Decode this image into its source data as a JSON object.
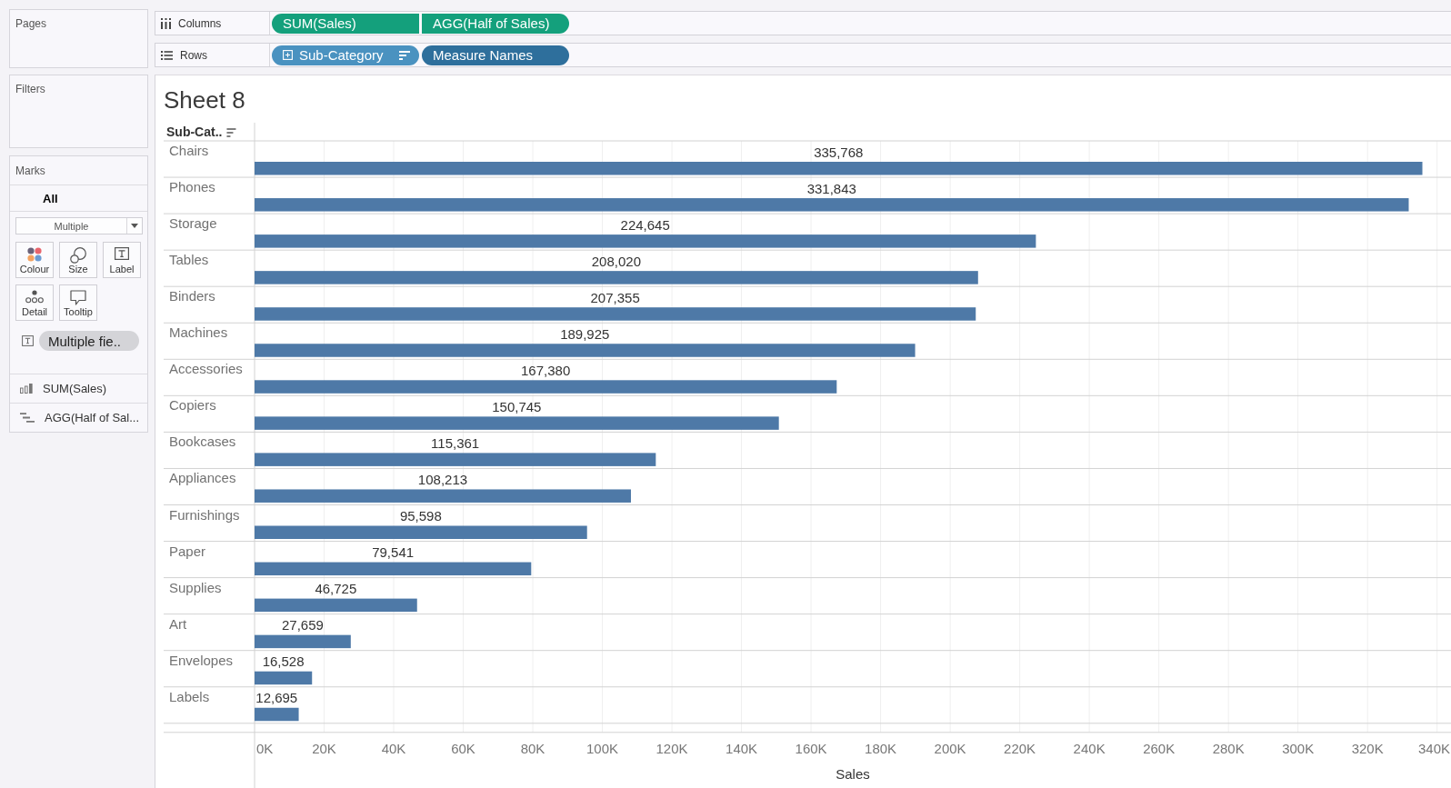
{
  "side_panel": {
    "pages": {
      "title": "Pages"
    },
    "filters": {
      "title": "Filters"
    },
    "marks": {
      "title": "Marks",
      "all_tab": {
        "label": "All",
        "selected": true
      },
      "mark_type": "Multiple",
      "buttons": [
        {
          "kind": "colour",
          "label": "Colour"
        },
        {
          "kind": "size",
          "label": "Size"
        },
        {
          "kind": "label",
          "label": "Label"
        },
        {
          "kind": "detail",
          "label": "Detail"
        },
        {
          "kind": "tooltip",
          "label": "Tooltip"
        }
      ],
      "fields": [
        {
          "kind": "label",
          "text": "Multiple fie.."
        }
      ],
      "measure_tabs": [
        {
          "kind": "bar",
          "label": "SUM(Sales)",
          "selected": false
        },
        {
          "kind": "gantt",
          "label": "AGG(Half of Sal...",
          "selected": false
        }
      ]
    }
  },
  "shelves": [
    {
      "kind": "columns",
      "label": "Columns",
      "joined": true,
      "pills": [
        {
          "text": "SUM(Sales)",
          "color": "#14a07c",
          "expand": false,
          "sorted": false
        },
        {
          "text": "AGG(Half of Sales)",
          "color": "#14a07c",
          "expand": false,
          "sorted": false
        }
      ]
    },
    {
      "kind": "rows",
      "label": "Rows",
      "joined": false,
      "pills": [
        {
          "text": "Sub-Category",
          "color": "#4a92c0",
          "expand": true,
          "sorted": true
        },
        {
          "text": "Measure Names",
          "color": "#2e6f9c",
          "expand": false,
          "sorted": false
        }
      ]
    }
  ],
  "sheet": {
    "title": "Sheet 8",
    "row_header": {
      "text": "Sub-Cat..",
      "sorted": true
    },
    "chart_data": {
      "type": "bar",
      "orientation": "horizontal",
      "xlabel": "Sales",
      "categories": [
        "Chairs",
        "Phones",
        "Storage",
        "Tables",
        "Binders",
        "Machines",
        "Accessories",
        "Copiers",
        "Bookcases",
        "Appliances",
        "Furnishings",
        "Paper",
        "Supplies",
        "Art",
        "Envelopes",
        "Labels"
      ],
      "values": [
        335768,
        331843,
        224645,
        208020,
        207355,
        189925,
        167380,
        150745,
        115361,
        108213,
        95598,
        79541,
        46725,
        27659,
        16528,
        12695
      ],
      "value_labels": [
        "335,768",
        "331,843",
        "224,645",
        "208,020",
        "207,355",
        "189,925",
        "167,380",
        "150,745",
        "115,361",
        "108,213",
        "95,598",
        "79,541",
        "46,725",
        "27,659",
        "16,528",
        "12,695"
      ],
      "color": "#4e79a7",
      "grid": true,
      "xlim": [
        0,
        344000
      ],
      "xticks": [
        {
          "value": 0,
          "label": "0K"
        },
        {
          "value": 20000,
          "label": "20K"
        },
        {
          "value": 40000,
          "label": "40K"
        },
        {
          "value": 60000,
          "label": "60K"
        },
        {
          "value": 80000,
          "label": "80K"
        },
        {
          "value": 100000,
          "label": "100K"
        },
        {
          "value": 120000,
          "label": "120K"
        },
        {
          "value": 140000,
          "label": "140K"
        },
        {
          "value": 160000,
          "label": "160K"
        },
        {
          "value": 180000,
          "label": "180K"
        },
        {
          "value": 200000,
          "label": "200K"
        },
        {
          "value": 220000,
          "label": "220K"
        },
        {
          "value": 240000,
          "label": "240K"
        },
        {
          "value": 260000,
          "label": "260K"
        },
        {
          "value": 280000,
          "label": "280K"
        },
        {
          "value": 300000,
          "label": "300K"
        },
        {
          "value": 320000,
          "label": "320K"
        },
        {
          "value": 340000,
          "label": "340K"
        }
      ]
    }
  }
}
